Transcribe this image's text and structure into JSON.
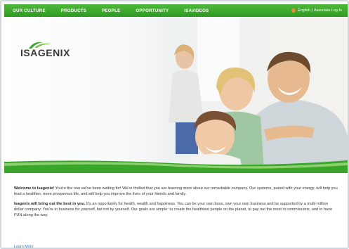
{
  "nav": {
    "items": [
      "OUR CULTURE",
      "PRODUCTS",
      "PEOPLE",
      "OPPORTUNITY",
      "ISAVIDEOS"
    ],
    "language": "English",
    "separator": "|",
    "login": "Associate Log In"
  },
  "hero": {
    "logo_text": "ISAGENIX",
    "icon": "leaf-swoosh-icon"
  },
  "content": {
    "p1_strong": "Welcome to Isagenix!",
    "p1_text": " You're the one we've been waiting for! We're thrilled that you are learning more about our remarkable company. Our systems, paired with your energy, will help you lead a healthier, more prosperous life, and will help you improve the lives of your friends and family.",
    "p2_strong": "Isagenix will bring out the best in you.",
    "p2_text": " It's an opportunity for health, wealth and happiness. You can be your own boss, own your own business and be supported by a multi-million dollar company. You're in business for yourself, but not by yourself. Our goals are simple: to create the healthiest people on the planet, to pay out the most in commissions, and to have FUN along the way.",
    "learn_more": "Learn More"
  },
  "colors": {
    "nav_green": "#3aa82c",
    "link_blue": "#2a70c4",
    "accent_orange": "#f08a3a"
  }
}
